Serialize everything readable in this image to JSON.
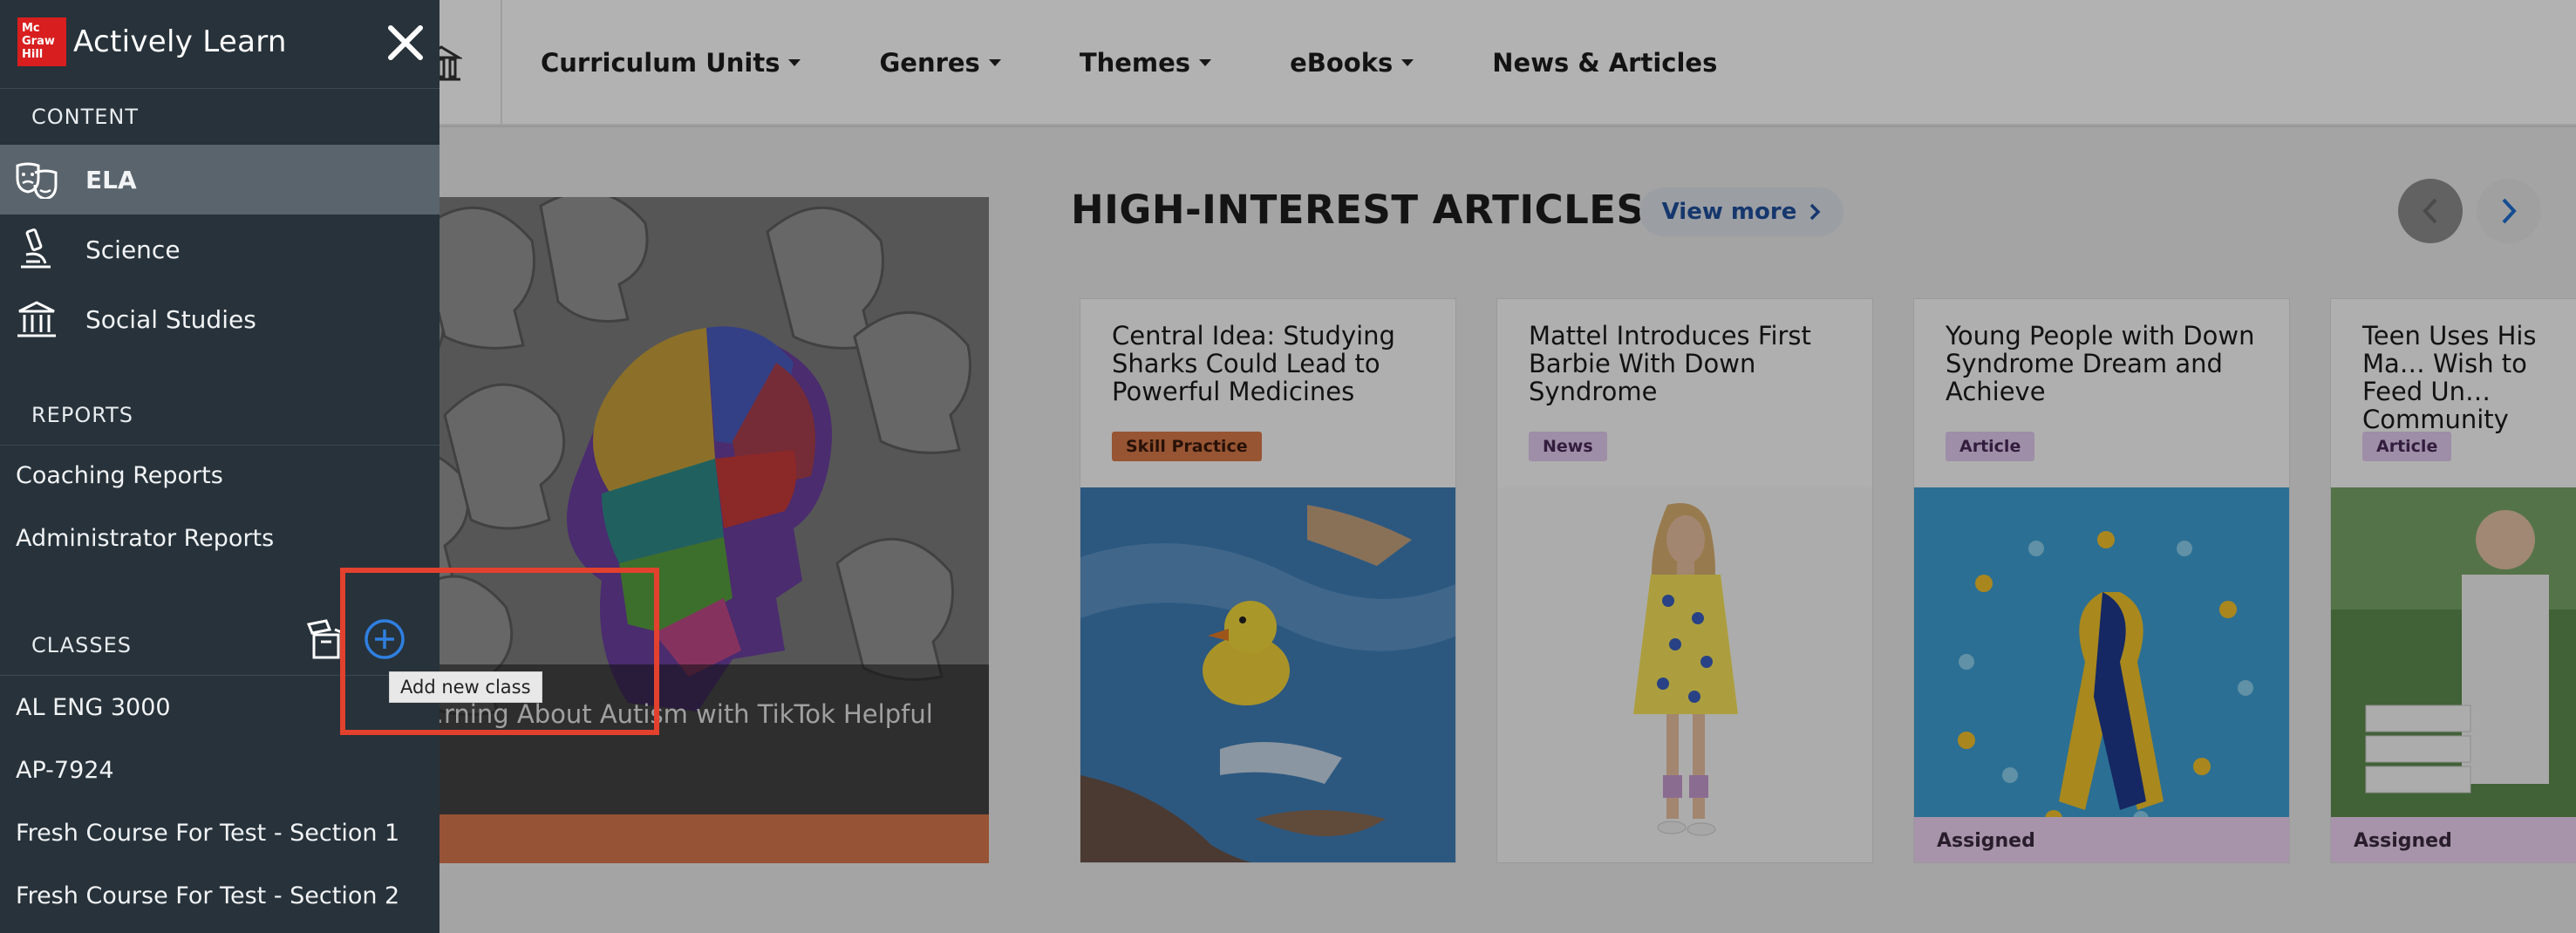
{
  "brand": {
    "logo_text": "Mc Graw Hill",
    "name": "Actively Learn"
  },
  "nav": {
    "items": [
      {
        "label": "Curriculum Units",
        "has_caret": true
      },
      {
        "label": "Genres",
        "has_caret": true
      },
      {
        "label": "Themes",
        "has_caret": true
      },
      {
        "label": "eBooks",
        "has_caret": true
      },
      {
        "label": "News & Articles",
        "has_caret": false
      }
    ]
  },
  "hero": {
    "caption": "…rning About Autism with TikTok Helpful"
  },
  "articles": {
    "title": "HIGH-INTEREST ARTICLES",
    "view_more": "View more",
    "cards": [
      {
        "title": "Central Idea: Studying Sharks Could Lead to Powerful Medicines",
        "badge": "Skill Practice",
        "badge_color": "#d97a4a",
        "assigned": ""
      },
      {
        "title": "Mattel Introduces First Barbie With Down Syndrome",
        "badge": "News",
        "badge_color": "#e3ccef",
        "assigned": ""
      },
      {
        "title": "Young People with Down Syndrome Dream and Achieve",
        "badge": "Article",
        "badge_color": "#e3ccef",
        "assigned": "Assigned"
      },
      {
        "title": "Teen Uses His Ma… Wish to Feed Un… Community",
        "badge": "Article",
        "badge_color": "#e3ccef",
        "assigned": "Assigned"
      }
    ]
  },
  "sidebar": {
    "content_heading": "CONTENT",
    "content_items": [
      {
        "label": "ELA",
        "icon": "theater-masks-icon",
        "active": true
      },
      {
        "label": "Science",
        "icon": "microscope-icon",
        "active": false
      },
      {
        "label": "Social Studies",
        "icon": "museum-icon",
        "active": false
      }
    ],
    "reports_heading": "REPORTS",
    "report_items": [
      "Coaching Reports",
      "Administrator Reports"
    ],
    "classes_heading": "CLASSES",
    "class_items": [
      "AL ENG 3000",
      "AP-7924",
      "Fresh Course For Test - Section 1",
      "Fresh Course For Test - Section 2"
    ],
    "add_class_tooltip": "Add new class"
  },
  "colors": {
    "sidebar_bg": "#27323a",
    "accent_blue": "#1f6fd1",
    "highlight_red": "#e2412e",
    "logo_red": "#d81e1e"
  }
}
